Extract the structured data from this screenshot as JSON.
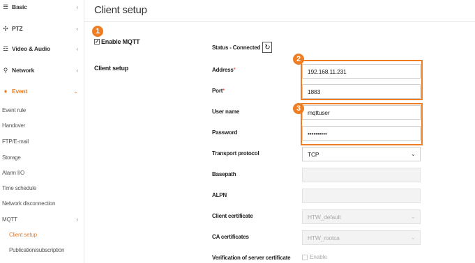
{
  "sidebar": {
    "items": [
      {
        "label": "Basic",
        "icon": "list-icon",
        "glyph": "☰"
      },
      {
        "label": "PTZ",
        "icon": "move-icon",
        "glyph": "✣"
      },
      {
        "label": "Video & Audio",
        "icon": "sliders-icon",
        "glyph": "☲"
      },
      {
        "label": "Network",
        "icon": "network-icon",
        "glyph": "⚲"
      },
      {
        "label": "Event",
        "icon": "bell-icon",
        "glyph": "♦"
      }
    ],
    "event_sub": [
      "Event rule",
      "Handover",
      "FTP/E-mail",
      "Storage",
      "Alarm I/O",
      "Time schedule",
      "Network disconnection",
      "MQTT"
    ],
    "mqtt_sub": [
      "Client setup",
      "Publication/subscription"
    ],
    "chevron_left": "‹",
    "chevron_down": "⌄"
  },
  "page": {
    "title": "Client setup",
    "enable_mqtt": "Enable MQTT",
    "section_label": "Client setup",
    "status_text": "Status - Connected",
    "refresh_glyph": "↻"
  },
  "fields": {
    "address": {
      "label": "Address",
      "value": "192.168.11.231"
    },
    "port": {
      "label": "Port",
      "value": "1883"
    },
    "user_name": {
      "label": "User name",
      "value": "mqttuser"
    },
    "password": {
      "label": "Password",
      "value": "••••••••••"
    },
    "transport_protocol": {
      "label": "Transport protocol",
      "value": "TCP"
    },
    "basepath": {
      "label": "Basepath",
      "value": ""
    },
    "alpn": {
      "label": "ALPN",
      "value": ""
    },
    "client_certificate": {
      "label": "Client certificate",
      "value": "HTW_default"
    },
    "ca_certificates": {
      "label": "CA certificates",
      "value": "HTW_rootca"
    },
    "verification": {
      "label": "Verification of server certificate",
      "value": "Enable"
    },
    "required_mark": "*",
    "select_chevron": "⌄"
  },
  "badges": [
    "1",
    "2",
    "3"
  ],
  "colors": {
    "accent": "#ef7d22",
    "required": "#e53935"
  }
}
